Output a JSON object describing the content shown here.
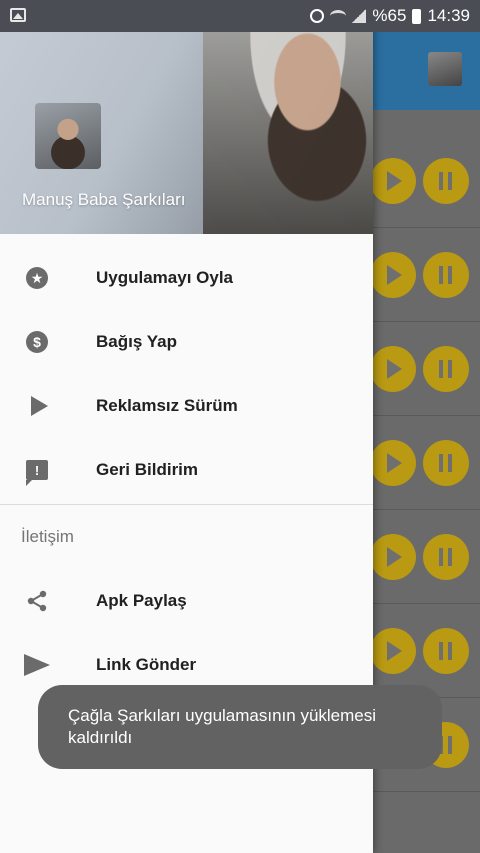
{
  "status_bar": {
    "battery": "%65",
    "time": "14:39"
  },
  "drawer": {
    "header_title": "Manuş Baba Şarkıları",
    "menu_items": [
      {
        "label": "Uygulamayı Oyla",
        "icon": "star-circle-icon"
      },
      {
        "label": "Bağış Yap",
        "icon": "dollar-circle-icon"
      },
      {
        "label": "Reklamsız Sürüm",
        "icon": "play-icon"
      },
      {
        "label": "Geri Bildirim",
        "icon": "feedback-icon"
      }
    ],
    "section_label": "İletişim",
    "contact_items": [
      {
        "label": "Apk Paylaş",
        "icon": "share-icon"
      },
      {
        "label": "Link Gönder",
        "icon": "send-icon"
      }
    ]
  },
  "toast": {
    "message": "Çağla Şarkıları uygulamasının yüklemesi kaldırıldı"
  },
  "colors": {
    "accent_yellow": "#f5c518",
    "toolbar_blue": "#2b6fa1",
    "icon_gray": "#6b6b6b"
  }
}
